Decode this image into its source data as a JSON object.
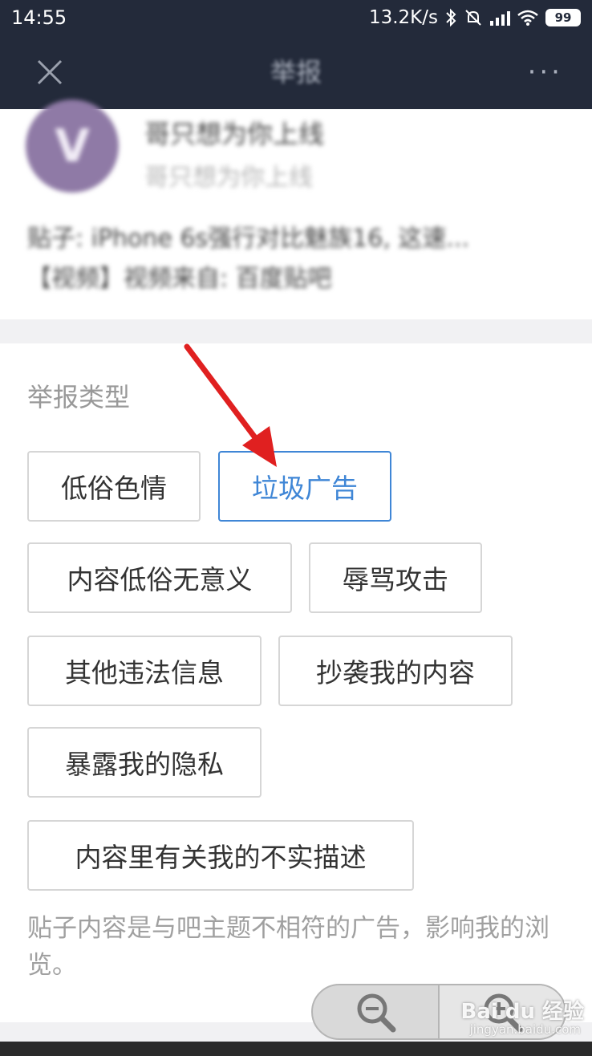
{
  "status_bar": {
    "time": "14:55",
    "speed": "13.2K/s",
    "battery": "99"
  },
  "nav": {
    "title": "举报",
    "more": "···"
  },
  "post": {
    "avatar_letter": "V",
    "name": "哥只想为你上线",
    "subtitle": "哥只想为你上线",
    "line1": "贴子: iPhone 6s强行对比魅族16, 这速...",
    "line2": "【视频】视频来自: 百度贴吧"
  },
  "report": {
    "section_title": "举报类型",
    "options": [
      "低俗色情",
      "垃圾广告",
      "内容低俗无意义",
      "辱骂攻击",
      "其他违法信息",
      "抄袭我的内容",
      "暴露我的隐私",
      "内容里有关我的不实描述"
    ],
    "selected": "垃圾广告",
    "description": "贴子内容是与吧主题不相符的广告，影响我的浏览。"
  },
  "watermark": {
    "brand": "Bai du 经验",
    "url": "jingyan.baidu.com"
  },
  "colors": {
    "header_bg": "#232a3a",
    "selected": "#3f86d6",
    "arrow": "#e02020"
  }
}
